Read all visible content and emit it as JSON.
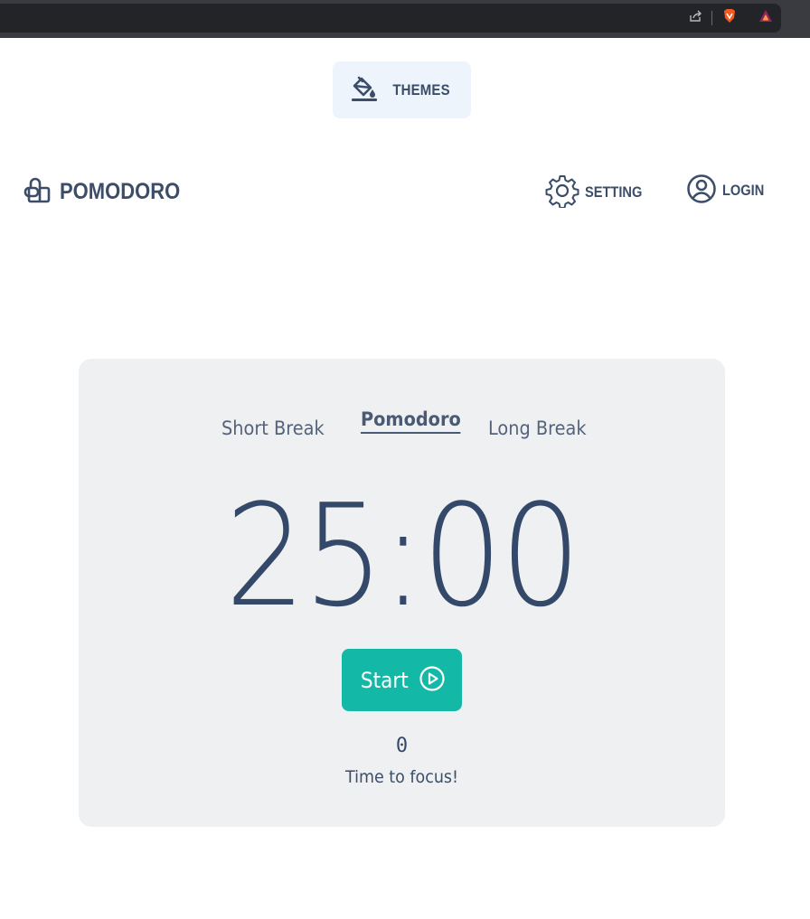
{
  "themes": {
    "label": "THEMES"
  },
  "header": {
    "logo_text": "POMODORO",
    "setting_label": "SETTING",
    "login_label": "LOGIN"
  },
  "modes": {
    "items": [
      "Short Break",
      "Pomodoro",
      "Long Break"
    ],
    "active": "Pomodoro"
  },
  "timer": {
    "display": "25:00"
  },
  "start": {
    "label": "Start"
  },
  "session": {
    "count": "0",
    "message": "Time to focus!"
  },
  "colors": {
    "text": "#3b4d68",
    "accent": "#14b8a6",
    "card": "#eff0f2",
    "themes_bg": "#eef4fc"
  },
  "icons": {
    "themes": "paint-bucket-icon",
    "logo": "pomodoro-logo-icon",
    "setting": "gear-icon",
    "login": "user-circle-icon",
    "start": "play-circle-icon"
  }
}
